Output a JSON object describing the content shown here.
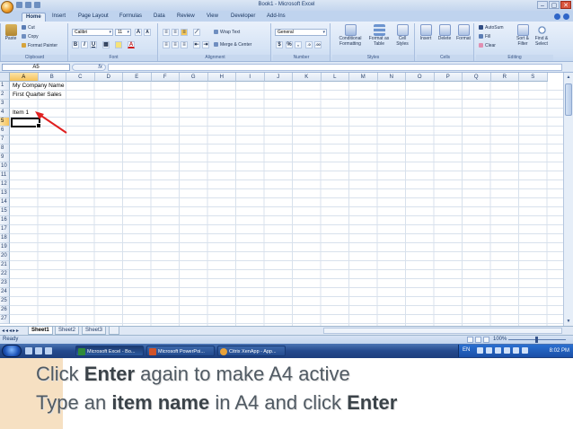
{
  "window": {
    "title": "Book1 - Microsoft Excel",
    "controls": [
      "–",
      "▢",
      "✕"
    ]
  },
  "ribbon_tabs": [
    "Home",
    "Insert",
    "Page Layout",
    "Formulas",
    "Data",
    "Review",
    "View",
    "Developer",
    "Add-Ins"
  ],
  "ribbon": {
    "clipboard": {
      "label": "Clipboard",
      "paste": "Paste",
      "cut": "Cut",
      "copy": "Copy",
      "format_painter": "Format Painter"
    },
    "font": {
      "label": "Font",
      "name": "Calibri",
      "size": "11",
      "bold": "B",
      "italic": "I",
      "underline": "U"
    },
    "alignment": {
      "label": "Alignment",
      "wrap": "Wrap Text",
      "merge": "Merge & Center"
    },
    "number": {
      "label": "Number",
      "format": "General",
      "currency": "$",
      "percent": "%",
      "comma": ","
    },
    "styles": {
      "label": "Styles",
      "conditional": "Conditional Formatting",
      "format_table": "Format as Table",
      "cell_styles": "Cell Styles"
    },
    "cells": {
      "label": "Cells",
      "insert": "Insert",
      "delete": "Delete",
      "format": "Format"
    },
    "editing": {
      "label": "Editing",
      "autosum": "AutoSum",
      "fill": "Fill",
      "clear": "Clear",
      "sort": "Sort & Filter",
      "find": "Find & Select"
    }
  },
  "formula_bar": {
    "name_box": "A5",
    "fx": "fx",
    "value": ""
  },
  "columns": [
    "A",
    "B",
    "C",
    "D",
    "E",
    "F",
    "G",
    "H",
    "I",
    "J",
    "K",
    "L",
    "M",
    "N",
    "O",
    "P",
    "Q",
    "R",
    "S"
  ],
  "rows": [
    "1",
    "2",
    "3",
    "4",
    "5",
    "6",
    "7",
    "8",
    "9",
    "10",
    "11",
    "12",
    "13",
    "14",
    "15",
    "16",
    "17",
    "18",
    "19",
    "20",
    "21",
    "22",
    "23",
    "24",
    "25",
    "26",
    "27"
  ],
  "cells": {
    "A1": "My Company Name",
    "A2": "First Quarter Sales",
    "A4": "Item 1"
  },
  "sheets": [
    "Sheet1",
    "Sheet2",
    "Sheet3"
  ],
  "status": {
    "mode": "Ready",
    "zoom": "100%"
  },
  "taskbar": {
    "items": [
      "Microsoft Excel - Bo...",
      "Microsoft PowerPoi...",
      "Citrix XenApp - App..."
    ],
    "lang": "EN",
    "clock": "8:02 PM"
  },
  "caption": {
    "line1": {
      "pre": "Click ",
      "bold": "Enter",
      "post": " again to make A4 active"
    },
    "line2": {
      "pre": "Type an ",
      "bold1": "item name",
      "mid": " in A4 and click ",
      "bold2": "Enter"
    }
  },
  "colors": {
    "arrow": "#e02020",
    "ribbon": "#dce7f5",
    "taskbar": "#244a8e"
  }
}
